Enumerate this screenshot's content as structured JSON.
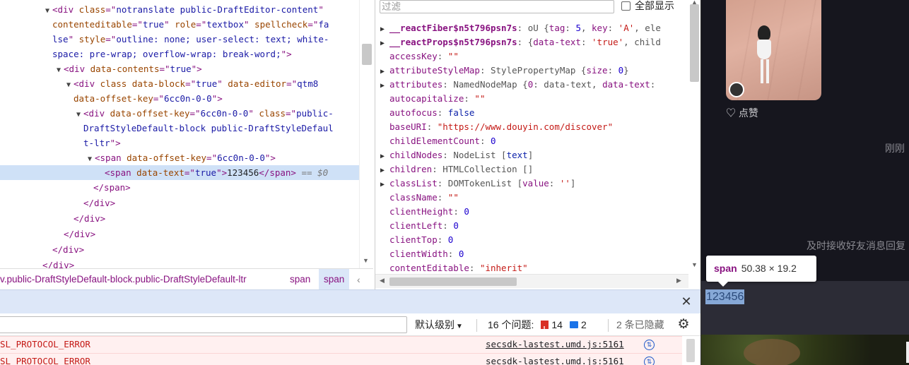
{
  "elements_panel": {
    "lines": [
      {
        "tri": "▼",
        "html_parts": [
          [
            "t",
            "<div "
          ],
          [
            "an",
            "class"
          ],
          [
            "t",
            "=\""
          ],
          [
            "av",
            "notranslate public-DraftEditor-content"
          ],
          [
            "t",
            "\""
          ]
        ]
      },
      {
        "tri": "",
        "html_parts": [
          [
            "an",
            "contenteditable"
          ],
          [
            "t",
            "=\""
          ],
          [
            "av",
            "true"
          ],
          [
            "t",
            "\" "
          ],
          [
            "an",
            "role"
          ],
          [
            "t",
            "=\""
          ],
          [
            "av",
            "textbox"
          ],
          [
            "t",
            "\" "
          ],
          [
            "an",
            "spellcheck"
          ],
          [
            "t",
            "=\""
          ],
          [
            "av",
            "fa"
          ]
        ]
      },
      {
        "tri": "",
        "html_parts": [
          [
            "av",
            "lse"
          ],
          [
            "t",
            "\" "
          ],
          [
            "an",
            "style"
          ],
          [
            "t",
            "=\""
          ],
          [
            "av",
            "outline: none; user-select: text; white-"
          ]
        ]
      },
      {
        "tri": "",
        "html_parts": [
          [
            "av",
            "space: pre-wrap; overflow-wrap: break-word;"
          ],
          [
            "t",
            "\">"
          ]
        ]
      },
      {
        "tri": "▼",
        "html_parts": [
          [
            "t",
            "<div "
          ],
          [
            "an",
            "data-contents"
          ],
          [
            "t",
            "=\""
          ],
          [
            "av",
            "true"
          ],
          [
            "t",
            "\">"
          ]
        ]
      },
      {
        "tri": "▼",
        "html_parts": [
          [
            "t",
            "<div "
          ],
          [
            "an",
            "class data-block"
          ],
          [
            "t",
            "=\""
          ],
          [
            "av",
            "true"
          ],
          [
            "t",
            "\" "
          ],
          [
            "an",
            "data-editor"
          ],
          [
            "t",
            "=\""
          ],
          [
            "av",
            "qtm8"
          ]
        ]
      },
      {
        "tri": "",
        "html_parts": [
          [
            "an",
            "data-offset-key"
          ],
          [
            "t",
            "=\""
          ],
          [
            "av",
            "6cc0n-0-0"
          ],
          [
            "t",
            "\">"
          ]
        ]
      },
      {
        "tri": "▼",
        "html_parts": [
          [
            "t",
            "<div "
          ],
          [
            "an",
            "data-offset-key"
          ],
          [
            "t",
            "=\""
          ],
          [
            "av",
            "6cc0n-0-0"
          ],
          [
            "t",
            "\" "
          ],
          [
            "an",
            "class"
          ],
          [
            "t",
            "=\""
          ],
          [
            "av",
            "public-"
          ]
        ]
      },
      {
        "tri": "",
        "html_parts": [
          [
            "av",
            "DraftStyleDefault-block public-DraftStyleDefaul"
          ]
        ]
      },
      {
        "tri": "",
        "html_parts": [
          [
            "av",
            "t-ltr"
          ],
          [
            "t",
            "\">"
          ]
        ]
      },
      {
        "tri": "▼",
        "html_parts": [
          [
            "t",
            "<span "
          ],
          [
            "an",
            "data-offset-key"
          ],
          [
            "t",
            "=\""
          ],
          [
            "av",
            "6cc0n-0-0"
          ],
          [
            "t",
            "\">"
          ]
        ]
      },
      {
        "tri": "",
        "html_parts": [
          [
            "t",
            "<span "
          ],
          [
            "an",
            "data-text"
          ],
          [
            "t",
            "=\""
          ],
          [
            "av",
            "true"
          ],
          [
            "t",
            "\">"
          ],
          [
            "tx",
            "123456"
          ],
          [
            "t",
            "</span>"
          ],
          [
            "eq",
            " == $0"
          ]
        ]
      },
      {
        "tri": "",
        "html_parts": [
          [
            "t",
            "</span>"
          ]
        ]
      },
      {
        "tri": "",
        "html_parts": [
          [
            "t",
            "</div>"
          ]
        ]
      },
      {
        "tri": "",
        "html_parts": [
          [
            "t",
            "</div>"
          ]
        ]
      },
      {
        "tri": "",
        "html_parts": [
          [
            "t",
            "</div>"
          ]
        ]
      },
      {
        "tri": "",
        "html_parts": [
          [
            "t",
            "</div>"
          ]
        ]
      },
      {
        "tri": "",
        "html_parts": [
          [
            "t",
            "</div>"
          ]
        ]
      }
    ]
  },
  "breadcrumb": {
    "items": [
      "v.public-DraftStyleDefault-block.public-DraftStyleDefault-ltr",
      "span",
      "span"
    ],
    "more": "‹"
  },
  "properties": {
    "filter_placeholder": "过滤",
    "show_all_label": "全部显示",
    "rows": [
      {
        "tri": "▶",
        "key": "__reactFiber$n5t796psn7s",
        "bold": true,
        "parts": [
          [
            "obj",
            "oU {"
          ],
          [
            "k",
            "tag"
          ],
          [
            "obj",
            ": "
          ],
          [
            "num",
            "5"
          ],
          [
            "obj",
            ", "
          ],
          [
            "k",
            "key"
          ],
          [
            "obj",
            ": "
          ],
          [
            "str",
            "'A'"
          ],
          [
            "obj",
            ", ele"
          ]
        ]
      },
      {
        "tri": "▶",
        "key": "__reactProps$n5t796psn7s",
        "bold": true,
        "parts": [
          [
            "obj",
            "{"
          ],
          [
            "k",
            "data-text"
          ],
          [
            "obj",
            ": "
          ],
          [
            "str",
            "'true'"
          ],
          [
            "obj",
            ", child"
          ]
        ]
      },
      {
        "tri": "",
        "key": "accessKey",
        "bold": false,
        "parts": [
          [
            "str",
            "\"\""
          ]
        ]
      },
      {
        "tri": "▶",
        "key": "attributeStyleMap",
        "bold": false,
        "parts": [
          [
            "obj",
            "StylePropertyMap {"
          ],
          [
            "k",
            "size"
          ],
          [
            "obj",
            ": "
          ],
          [
            "num",
            "0"
          ],
          [
            "obj",
            "}"
          ]
        ]
      },
      {
        "tri": "▶",
        "key": "attributes",
        "bold": false,
        "parts": [
          [
            "obj",
            "NamedNodeMap {"
          ],
          [
            "k",
            "0"
          ],
          [
            "obj",
            ": data-text, "
          ],
          [
            "k",
            "data-text"
          ],
          [
            "obj",
            ":"
          ]
        ]
      },
      {
        "tri": "",
        "key": "autocapitalize",
        "bold": false,
        "parts": [
          [
            "str",
            "\"\""
          ]
        ]
      },
      {
        "tri": "",
        "key": "autofocus",
        "bold": false,
        "parts": [
          [
            "kw",
            "false"
          ]
        ]
      },
      {
        "tri": "",
        "key": "baseURI",
        "bold": false,
        "parts": [
          [
            "str",
            "\"https://www.douyin.com/discover\""
          ]
        ]
      },
      {
        "tri": "",
        "key": "childElementCount",
        "bold": false,
        "parts": [
          [
            "num",
            "0"
          ]
        ]
      },
      {
        "tri": "▶",
        "key": "childNodes",
        "bold": false,
        "parts": [
          [
            "obj",
            "NodeList ["
          ],
          [
            "kw",
            "text"
          ],
          [
            "obj",
            "]"
          ]
        ]
      },
      {
        "tri": "▶",
        "key": "children",
        "bold": false,
        "parts": [
          [
            "obj",
            "HTMLCollection []"
          ]
        ]
      },
      {
        "tri": "▶",
        "key": "classList",
        "bold": false,
        "parts": [
          [
            "obj",
            "DOMTokenList ["
          ],
          [
            "k",
            "value"
          ],
          [
            "obj",
            ": "
          ],
          [
            "str",
            "''"
          ],
          [
            "obj",
            "]"
          ]
        ]
      },
      {
        "tri": "",
        "key": "className",
        "bold": false,
        "parts": [
          [
            "str",
            "\"\""
          ]
        ]
      },
      {
        "tri": "",
        "key": "clientHeight",
        "bold": false,
        "parts": [
          [
            "num",
            "0"
          ]
        ]
      },
      {
        "tri": "",
        "key": "clientLeft",
        "bold": false,
        "parts": [
          [
            "num",
            "0"
          ]
        ]
      },
      {
        "tri": "",
        "key": "clientTop",
        "bold": false,
        "parts": [
          [
            "num",
            "0"
          ]
        ]
      },
      {
        "tri": "",
        "key": "clientWidth",
        "bold": false,
        "parts": [
          [
            "num",
            "0"
          ]
        ]
      },
      {
        "tri": "",
        "key": "contentEditable",
        "bold": false,
        "parts": [
          [
            "str",
            "\"inherit\""
          ]
        ]
      }
    ]
  },
  "console": {
    "levels_label": "默认级别",
    "issues_label": "16 个问题:",
    "error_count": "14",
    "info_count": "2",
    "hidden_label": "2 条已隐藏",
    "errors": [
      {
        "message": "SL_PROTOCOL_ERROR",
        "source": "secsdk-lastest.umd.js:5161"
      },
      {
        "message": "SL PROTOCOL ERROR",
        "source": "secsdk-lastest.umd.js:5161"
      }
    ]
  },
  "webpage": {
    "like_label": "点赞",
    "time_label": "刚刚",
    "notice": "及时接收好友消息回复",
    "tooltip_tag": "span",
    "tooltip_size": "50.38 × 19.2",
    "input_text": "123456"
  }
}
